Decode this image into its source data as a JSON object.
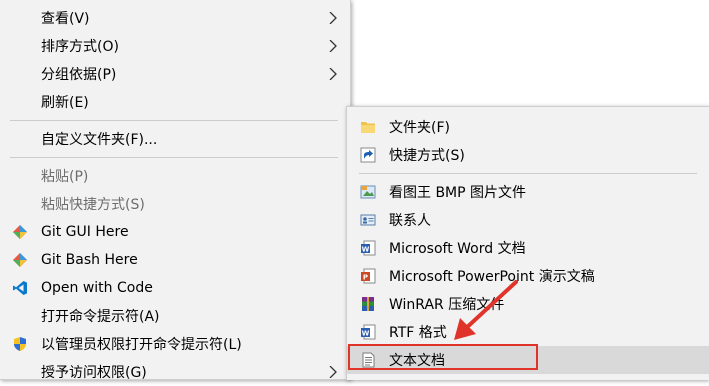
{
  "main_menu": {
    "items": [
      {
        "label": "查看(V)"
      },
      {
        "label": "排序方式(O)"
      },
      {
        "label": "分组依据(P)"
      },
      {
        "label": "刷新(E)"
      },
      {
        "label": "自定义文件夹(F)..."
      },
      {
        "label": "粘贴(P)"
      },
      {
        "label": "粘贴快捷方式(S)"
      },
      {
        "label": "Git GUI Here"
      },
      {
        "label": "Git Bash Here"
      },
      {
        "label": "Open with Code"
      },
      {
        "label": "打开命令提示符(A)"
      },
      {
        "label": "以管理员权限打开命令提示符(L)"
      },
      {
        "label": "授予访问权限(G)"
      }
    ]
  },
  "new_submenu": {
    "items": [
      {
        "label": "文件夹(F)",
        "icon": "folder-icon"
      },
      {
        "label": "快捷方式(S)",
        "icon": "shortcut-icon"
      },
      {
        "label": "看图王 BMP 图片文件",
        "icon": "bmp-image-icon"
      },
      {
        "label": "联系人",
        "icon": "contact-icon"
      },
      {
        "label": "Microsoft Word 文档",
        "icon": "word-icon"
      },
      {
        "label": "Microsoft PowerPoint 演示文稿",
        "icon": "powerpoint-icon"
      },
      {
        "label": "WinRAR 压缩文件",
        "icon": "winrar-icon"
      },
      {
        "label": "RTF 格式",
        "icon": "rtf-icon"
      },
      {
        "label": "文本文档",
        "icon": "text-document-icon"
      }
    ],
    "highlighted_item": "文本文档"
  },
  "colors": {
    "menu_bg": "#f2f2f2",
    "highlight": "#d9d9d9",
    "annotation": "#e0342b",
    "disabled_text": "#6d6d6d"
  }
}
